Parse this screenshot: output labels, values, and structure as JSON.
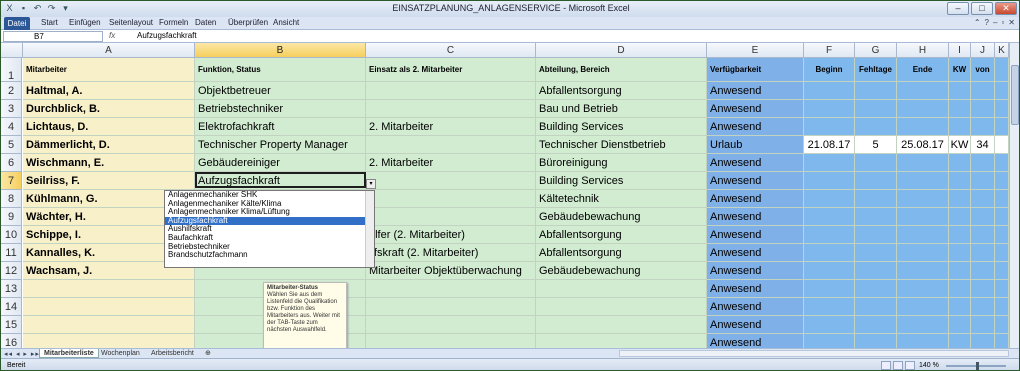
{
  "window": {
    "title": "EINSATZPLANUNG_ANLAGENSERVICE - Microsoft Excel",
    "qat_icons": [
      "excel-icon",
      "save-icon",
      "undo-icon",
      "redo-icon",
      "customize-icon"
    ]
  },
  "ribbon": {
    "tabs": [
      "Datei",
      "Start",
      "Einfügen",
      "Seitenlayout",
      "Formeln",
      "Daten",
      "Überprüfen",
      "Ansicht"
    ]
  },
  "formula_bar": {
    "name_box": "B7",
    "fx": "fx",
    "value": "Aufzugsfachkraft"
  },
  "columns": [
    "A",
    "B",
    "C",
    "D",
    "E",
    "F",
    "G",
    "H",
    "I",
    "J",
    "K"
  ],
  "header_row": {
    "A": "Mitarbeiter",
    "B": "Funktion, Status",
    "C": "Einsatz als 2. Mitarbeiter",
    "D": "Abteilung, Bereich",
    "E": "Verfügbarkeit",
    "F": "Beginn",
    "G": "Fehltage",
    "H": "Ende",
    "I": "KW",
    "J": "von"
  },
  "rows": [
    {
      "n": "2",
      "A": "Haltmal, A.",
      "B": "Objektbetreuer",
      "C": "",
      "D": "Abfallentsorgung",
      "E": "Anwesend"
    },
    {
      "n": "3",
      "A": "Durchblick, B.",
      "B": "Betriebstechniker",
      "C": "",
      "D": "Bau und Betrieb",
      "E": "Anwesend"
    },
    {
      "n": "4",
      "A": "Lichtaus, D.",
      "B": "Elektrofachkraft",
      "C": "2. Mitarbeiter",
      "D": "Building Services",
      "E": "Anwesend"
    },
    {
      "n": "5",
      "A": "Dämmerlicht, D.",
      "B": "Technischer Property Manager",
      "C": "",
      "D": "Technischer Dienstbetrieb",
      "E": "Urlaub",
      "F": "21.08.17",
      "G": "5",
      "H": "25.08.17",
      "I": "KW",
      "J": "34"
    },
    {
      "n": "6",
      "A": "Wischmann, E.",
      "B": "Gebäudereiniger",
      "C": "2. Mitarbeiter",
      "D": "Büroreinigung",
      "E": "Anwesend"
    },
    {
      "n": "7",
      "A": "Seilriss, F.",
      "B": "Aufzugsfachkraft",
      "C": "",
      "D": "Building Services",
      "E": "Anwesend"
    },
    {
      "n": "8",
      "A": "Kühlmann, G.",
      "B": "",
      "C": "",
      "D": "Kältetechnik",
      "E": "Anwesend"
    },
    {
      "n": "9",
      "A": "Wächter, H.",
      "B": "",
      "C": "",
      "D": "Gebäudebewachung",
      "E": "Anwesend"
    },
    {
      "n": "10",
      "A": "Schippe, I.",
      "B": "",
      "C": "elfer (2. Mitarbeiter)",
      "D": "Abfallentsorgung",
      "E": "Anwesend"
    },
    {
      "n": "11",
      "A": "Kannalles, K.",
      "B": "",
      "C": "ilfskraft (2. Mitarbeiter)",
      "D": "Abfallentsorgung",
      "E": "Anwesend"
    },
    {
      "n": "12",
      "A": "Wachsam, J.",
      "B": "",
      "C": "Mitarbeiter Objektüberwachung",
      "D": "Gebäudebewachung",
      "E": "Anwesend"
    },
    {
      "n": "13",
      "A": "",
      "B": "",
      "C": "",
      "D": "",
      "E": "Anwesend"
    },
    {
      "n": "14",
      "A": "",
      "B": "",
      "C": "",
      "D": "",
      "E": "Anwesend"
    },
    {
      "n": "15",
      "A": "",
      "B": "",
      "C": "",
      "D": "",
      "E": "Anwesend"
    },
    {
      "n": "16",
      "A": "",
      "B": "",
      "C": "",
      "D": "",
      "E": "Anwesend"
    }
  ],
  "dropdown": {
    "items": [
      "Anlagenmechaniker SHK",
      "Anlagenmechaniker Kälte/Klima",
      "Anlagenmechaniker Klima/Lüftung",
      "Aufzugsfachkraft",
      "Aushilfskraft",
      "Baufachkraft",
      "Betriebstechniker",
      "Brandschutzfachmann"
    ],
    "selected_index": 3
  },
  "tooltip": {
    "title": "Mitarbeiter-Status",
    "text": "Wählen Sie aus dem Listenfeld die Qualifikation bzw. Funktion des Mitarbeiters aus. Weiter mit der TAB-Taste zum nächsten Auswahlfeld."
  },
  "sheet_tabs": [
    "Mitarbeiterliste",
    "Wochenplan",
    "Arbeitsbericht"
  ],
  "active_sheet": "Mitarbeiterliste",
  "status": {
    "ready": "Bereit",
    "zoom": "140 %"
  },
  "colors": {
    "name_col": "#f8f0c8",
    "green_cols": "#d2ecd2",
    "blue_cols": "#80b0e8",
    "selected_header": "#f6cf5c"
  }
}
